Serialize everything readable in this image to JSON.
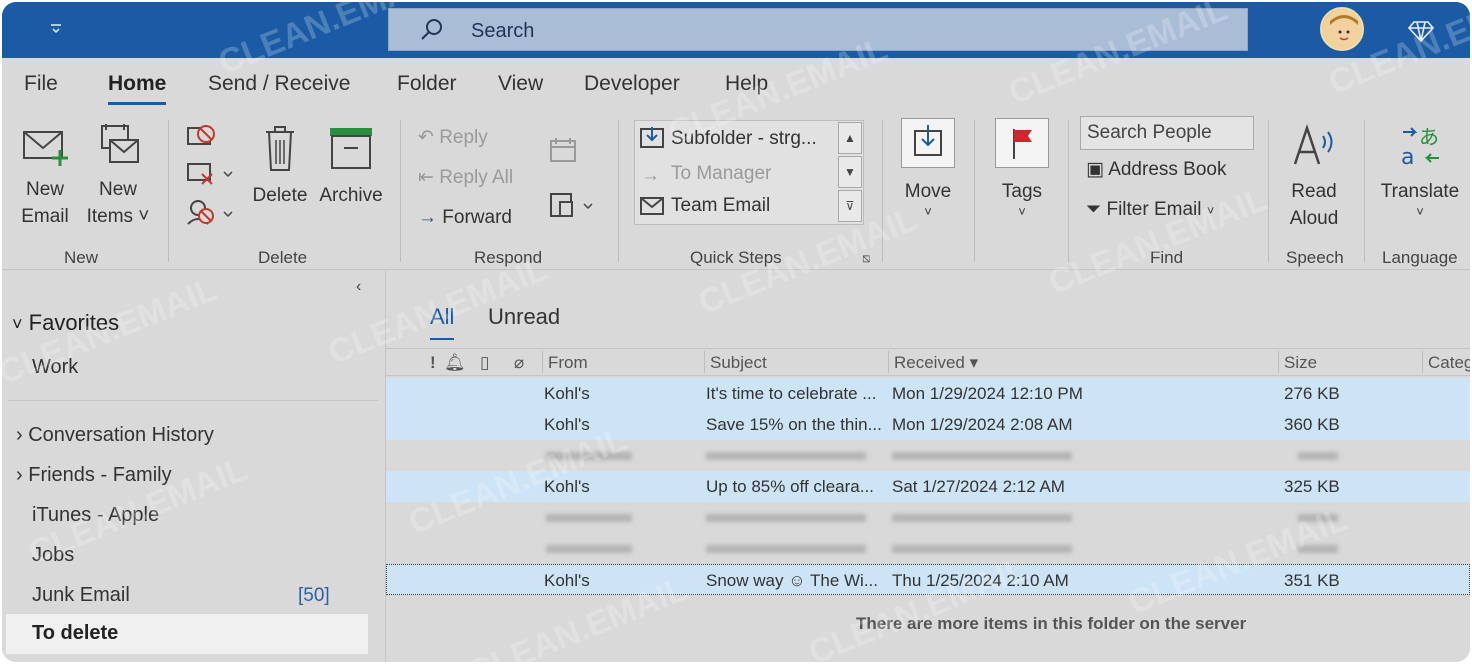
{
  "title_bar": {
    "search_placeholder": "Search"
  },
  "menu": {
    "tabs": [
      "File",
      "Home",
      "Send / Receive",
      "Folder",
      "View",
      "Developer",
      "Help"
    ],
    "active": "Home"
  },
  "ribbon": {
    "new_group": {
      "label": "New",
      "new_email": [
        "New",
        "Email"
      ],
      "new_items": [
        "New",
        "Items ˅"
      ]
    },
    "delete_group": {
      "label": "Delete",
      "delete": "Delete",
      "archive": "Archive"
    },
    "respond_group": {
      "label": "Respond",
      "reply": "Reply",
      "reply_all": "Reply All",
      "forward": "Forward"
    },
    "quick_steps": {
      "label": "Quick Steps",
      "items": [
        "Subfolder - strg...",
        "To Manager",
        "Team Email"
      ]
    },
    "move": {
      "label": "Move"
    },
    "tags": {
      "label": "Tags"
    },
    "find_group": {
      "label": "Find",
      "search_people": "Search People",
      "address_book": "Address Book",
      "filter_email": "Filter Email"
    },
    "speech_group": {
      "label": "Speech",
      "read_aloud": [
        "Read",
        "Aloud"
      ]
    },
    "language_group": {
      "label": "Language",
      "translate": "Translate"
    }
  },
  "folders": {
    "favorites_header": "Favorites",
    "favorites": [
      "Work"
    ],
    "items": [
      {
        "label": "Conversation History",
        "expandable": true
      },
      {
        "label": "Friends - Family",
        "expandable": true
      },
      {
        "label": "iTunes - Apple",
        "expandable": false
      },
      {
        "label": "Jobs",
        "expandable": false
      },
      {
        "label": "Junk Email",
        "expandable": false,
        "count": "[50]"
      },
      {
        "label": "To delete",
        "expandable": false,
        "selected": true
      }
    ]
  },
  "message_list": {
    "tabs": [
      "All",
      "Unread"
    ],
    "columns": {
      "flags": "!",
      "from": "From",
      "subject": "Subject",
      "received": "Received",
      "size": "Size",
      "category": "Categ"
    },
    "rows": [
      {
        "from": "Kohl's",
        "subject": "It's time to celebrate ...",
        "received": "Mon 1/29/2024 12:10 PM",
        "size": "276 KB",
        "selected": true
      },
      {
        "from": "Kohl's",
        "subject": "Save 15% on the thin...",
        "received": "Mon 1/29/2024 2:08 AM",
        "size": "360 KB",
        "selected": true
      },
      {
        "from": "",
        "subject": "",
        "received": "",
        "size": "",
        "blurred": true
      },
      {
        "from": "Kohl's",
        "subject": "Up to 85% off cleara...",
        "received": "Sat 1/27/2024 2:12 AM",
        "size": "325 KB",
        "selected": true
      },
      {
        "from": "",
        "subject": "",
        "received": "",
        "size": "",
        "blurred": true
      },
      {
        "from": "",
        "subject": "",
        "received": "",
        "size": "",
        "blurred": true
      },
      {
        "from": "Kohl's",
        "subject": "Snow way ☺ The Wi...",
        "received": "Thu 1/25/2024 2:10 AM",
        "size": "351 KB",
        "selected": true
      }
    ],
    "server_note": "There are more items in this folder on the server"
  },
  "watermark": "CLEAN.EMAIL",
  "colors": {
    "accent": "#1b5ba6",
    "selection": "#cde3f6",
    "background": "#d9d9d9"
  }
}
